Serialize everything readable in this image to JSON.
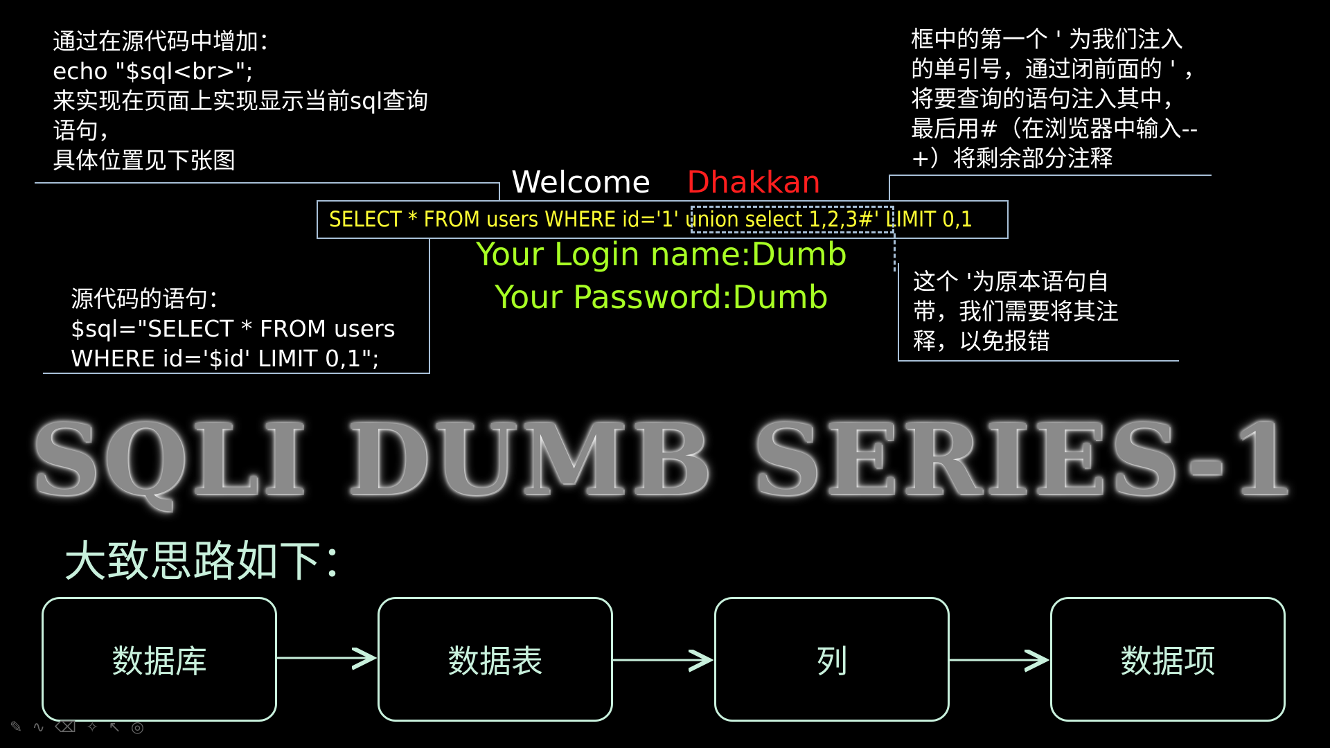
{
  "notes": {
    "top_left": "通过在源代码中增加：\necho \"$sql<br>\";\n来实现在页面上实现显示当前sql查询\n语句，\n具体位置见下张图",
    "top_right": "框中的第一个 ' 为我们注入\n的单引号，通过闭前面的 ' ，\n将要查询的语句注入其中，\n最后用#（在浏览器中输入--\n+）将剩余部分注释",
    "bottom_left": "源代码的语句：\n$sql=\"SELECT * FROM users\nWHERE id='$id' LIMIT 0,1\";",
    "bottom_right": "这个 '为原本语句自\n带，我们需要将其注\n释，以免报错"
  },
  "page": {
    "welcome": "Welcome",
    "user": "Dhakkan",
    "sql_query": "SELECT * FROM users WHERE id='1' union select 1,2,3#' LIMIT 0,1",
    "login": "Your Login name:Dumb",
    "password": "Your Password:Dumb"
  },
  "banner": "SQLI DUMB SERIES-1",
  "section_heading": "大致思路如下：",
  "flow": [
    "数据库",
    "数据表",
    "列",
    "数据项"
  ],
  "toolbar_icons": [
    "pen-icon",
    "highlighter-icon",
    "eraser-icon",
    "laser-pointer-icon",
    "pointer-icon",
    "settings-icon"
  ],
  "colors": {
    "background": "#000000",
    "user": "#ff1e1e",
    "sql": "#ffff33",
    "login": "#a8ff24",
    "flow": "#c8f0dc",
    "connector": "#a8c0d8"
  }
}
